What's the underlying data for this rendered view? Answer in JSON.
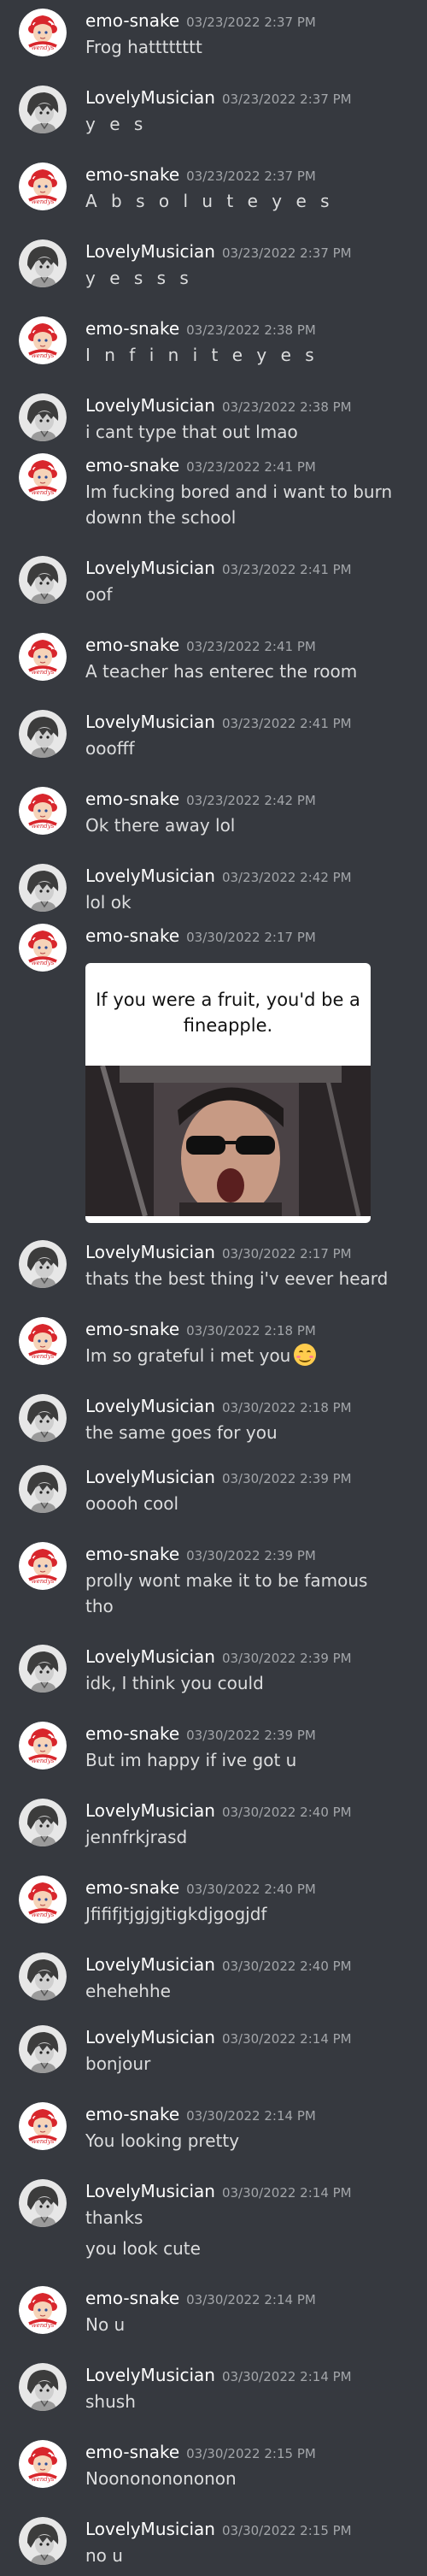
{
  "users": {
    "emo": "emo-snake",
    "lovely": "LovelyMusician"
  },
  "colors": {
    "background": "#36393f",
    "username": "#ffffff",
    "timestamp": "#a3a6aa",
    "message_text": "#dcddde"
  },
  "messages": [
    {
      "user": "emo-snake",
      "time": "03/23/2022 2:37 PM",
      "lines": [
        "Frog hatttttttt"
      ]
    },
    {
      "user": "LovelyMusician",
      "time": "03/23/2022 2:37 PM",
      "lines": [
        "y e s"
      ]
    },
    {
      "user": "emo-snake",
      "time": "03/23/2022 2:37 PM",
      "lines": [
        "A b s o l u t e y e s"
      ]
    },
    {
      "user": "LovelyMusician",
      "time": "03/23/2022 2:37 PM",
      "lines": [
        "y e s s s"
      ]
    },
    {
      "user": "emo-snake",
      "time": "03/23/2022 2:38 PM",
      "lines": [
        "I n f i n i t e y e s"
      ]
    },
    {
      "user": "LovelyMusician",
      "time": "03/23/2022 2:38 PM",
      "lines": [
        "i cant type that out lmao"
      ]
    },
    {
      "user": "emo-snake",
      "time": "03/23/2022 2:41 PM",
      "lines": [
        "Im fucking bored and i want to burn downn the school"
      ]
    },
    {
      "user": "LovelyMusician",
      "time": "03/23/2022 2:41 PM",
      "lines": [
        "oof"
      ]
    },
    {
      "user": "emo-snake",
      "time": "03/23/2022 2:41 PM",
      "lines": [
        "A teacher has enterec the room"
      ]
    },
    {
      "user": "LovelyMusician",
      "time": "03/23/2022 2:41 PM",
      "lines": [
        "ooofff"
      ]
    },
    {
      "user": "emo-snake",
      "time": "03/23/2022 2:42 PM",
      "lines": [
        "Ok there away lol"
      ]
    },
    {
      "user": "LovelyMusician",
      "time": "03/23/2022 2:42 PM",
      "lines": [
        "lol ok"
      ]
    },
    {
      "user": "emo-snake",
      "time": "03/30/2022 2:17 PM",
      "embed_text": "If you were a fruit, you'd be a fineapple."
    },
    {
      "user": "LovelyMusician",
      "time": "03/30/2022 2:17 PM",
      "lines": [
        "thats the best thing i'v eever heard"
      ]
    },
    {
      "user": "emo-snake",
      "time": "03/30/2022 2:18 PM",
      "lines": [
        "Im so grateful i met you"
      ]
    },
    {
      "user": "LovelyMusician",
      "time": "03/30/2022 2:18 PM",
      "lines": [
        "the same goes for you"
      ]
    },
    {
      "user": "LovelyMusician",
      "time": "03/30/2022 2:39 PM",
      "lines": [
        "ooooh cool"
      ]
    },
    {
      "user": "emo-snake",
      "time": "03/30/2022 2:39 PM",
      "lines": [
        "prolly wont make it to be famous tho"
      ]
    },
    {
      "user": "LovelyMusician",
      "time": "03/30/2022 2:39 PM",
      "lines": [
        "idk, I think you could"
      ]
    },
    {
      "user": "emo-snake",
      "time": "03/30/2022 2:39 PM",
      "lines": [
        "But im happy if ive got u"
      ]
    },
    {
      "user": "LovelyMusician",
      "time": "03/30/2022 2:40 PM",
      "lines": [
        "jennfrkjrasd"
      ]
    },
    {
      "user": "emo-snake",
      "time": "03/30/2022 2:40 PM",
      "lines": [
        "Jfififjtjgjgjtigkdjgogjdf"
      ]
    },
    {
      "user": "LovelyMusician",
      "time": "03/30/2022 2:40 PM",
      "lines": [
        "ehehehhe"
      ]
    },
    {
      "user": "LovelyMusician",
      "time": "03/30/2022 2:14 PM",
      "lines": [
        "bonjour"
      ]
    },
    {
      "user": "emo-snake",
      "time": "03/30/2022 2:14 PM",
      "lines": [
        "You looking pretty"
      ]
    },
    {
      "user": "LovelyMusician",
      "time": "03/30/2022 2:14 PM",
      "lines": [
        "thanks",
        "you look cute"
      ]
    },
    {
      "user": "emo-snake",
      "time": "03/30/2022 2:14 PM",
      "lines": [
        "No u"
      ]
    },
    {
      "user": "LovelyMusician",
      "time": "03/30/2022 2:14 PM",
      "lines": [
        "shush"
      ]
    },
    {
      "user": "emo-snake",
      "time": "03/30/2022 2:15 PM",
      "lines": [
        "Noonononononon"
      ]
    },
    {
      "user": "LovelyMusician",
      "time": "03/30/2022 2:15 PM",
      "lines": [
        "no u"
      ]
    }
  ],
  "icons": {
    "emo_avatar": "red-haired-mascot-avatar-icon",
    "lovely_avatar": "gray-anime-character-avatar-icon",
    "reaction_emoji": "smiling-face-emoji-icon"
  }
}
